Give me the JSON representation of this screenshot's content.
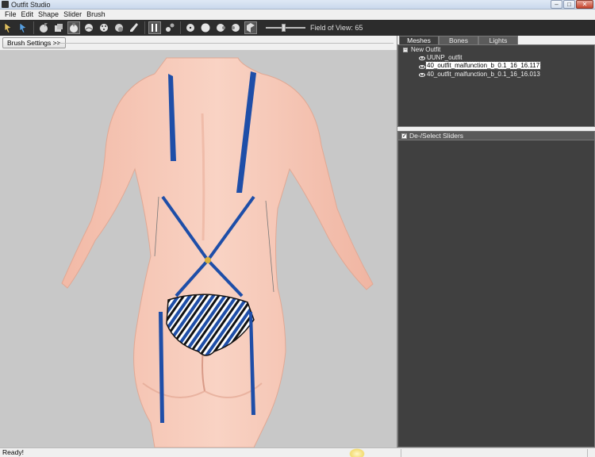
{
  "window": {
    "title": "Outfit Studio",
    "controls": {
      "minimize": "–",
      "maximize": "□",
      "close": "✕"
    }
  },
  "menu": [
    "File",
    "Edit",
    "Shape",
    "Slider",
    "Brush"
  ],
  "toolbar": {
    "tools": [
      "select-tool",
      "transform-tool",
      "brush-standard",
      "brush-deflate",
      "brush-move",
      "brush-smooth",
      "brush-inflate",
      "brush-mask",
      "brush-unmask",
      "brush-weight",
      "edit-toggle",
      "weight-paint",
      "vertex-view",
      "wireframe-view",
      "lighting-view",
      "shade-view",
      "texture-view"
    ],
    "active_tool": "select-tool",
    "fov_label": "Field of View: 65",
    "fov_value": 65
  },
  "brush_settings": {
    "label": "Brush Settings >>"
  },
  "tabs": [
    {
      "label": "Meshes",
      "active": true
    },
    {
      "label": "Bones",
      "active": false
    },
    {
      "label": "Lights",
      "active": false
    }
  ],
  "mesh_tree": {
    "root": "New Outfit",
    "root_toggle": "−",
    "items": [
      {
        "label": "UUNP_outfit",
        "selected": false
      },
      {
        "label": "40_outfit_malfunction_b_0.1_16_16.117",
        "selected": true
      },
      {
        "label": "40_outfit_malfunction_b_0.1_16_16.013",
        "selected": false
      }
    ]
  },
  "sliders": {
    "header": "De-/Select Sliders",
    "checked": true,
    "check_glyph": "✓"
  },
  "status": {
    "text": "Ready!"
  },
  "colors": {
    "toolbar_bg": "#2c2c2c",
    "panel_bg": "#404040",
    "viewport_bg": "#c8c8c8",
    "skin": "#f6c6b5",
    "strap_blue": "#1e4ea8"
  }
}
